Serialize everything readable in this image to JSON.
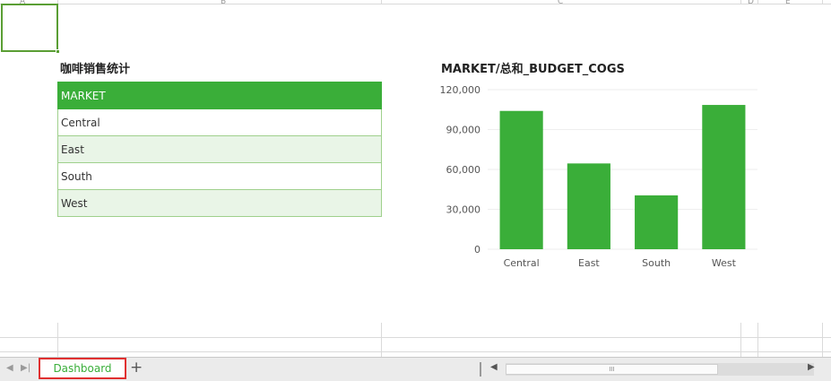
{
  "sheet": {
    "col_letters": [
      "A",
      "B",
      "C",
      "D",
      "E"
    ],
    "dashboard_title": "咖啡销售统计",
    "table": {
      "header": "MARKET",
      "rows": [
        "Central",
        "East",
        "South",
        "West"
      ]
    }
  },
  "chart_data": {
    "type": "bar",
    "title": "MARKET/总和_BUDGET_COGS",
    "categories": [
      "Central",
      "East",
      "South",
      "West"
    ],
    "values": [
      104000,
      64500,
      40500,
      108500
    ],
    "ylim": [
      0,
      120000
    ],
    "yticks": [
      0,
      30000,
      60000,
      90000,
      120000
    ],
    "ytick_labels": [
      "0",
      "30,000",
      "60,000",
      "90,000",
      "120,000"
    ],
    "xlabel": "",
    "ylabel": "",
    "grid": true,
    "legend": "none",
    "bar_color": "#3aae39"
  },
  "tabs": {
    "sheets": [
      "Dashboard"
    ],
    "active": "Dashboard",
    "add_symbol": "+",
    "first_icon": "first-sheet-icon",
    "prev_icon": "prev-sheet-icon"
  },
  "scrollbar": {
    "thumb_grip": "III"
  },
  "colors": {
    "accent": "#3aae39",
    "row_alt": "#e9f5e7",
    "tab_border": "#e03030"
  }
}
